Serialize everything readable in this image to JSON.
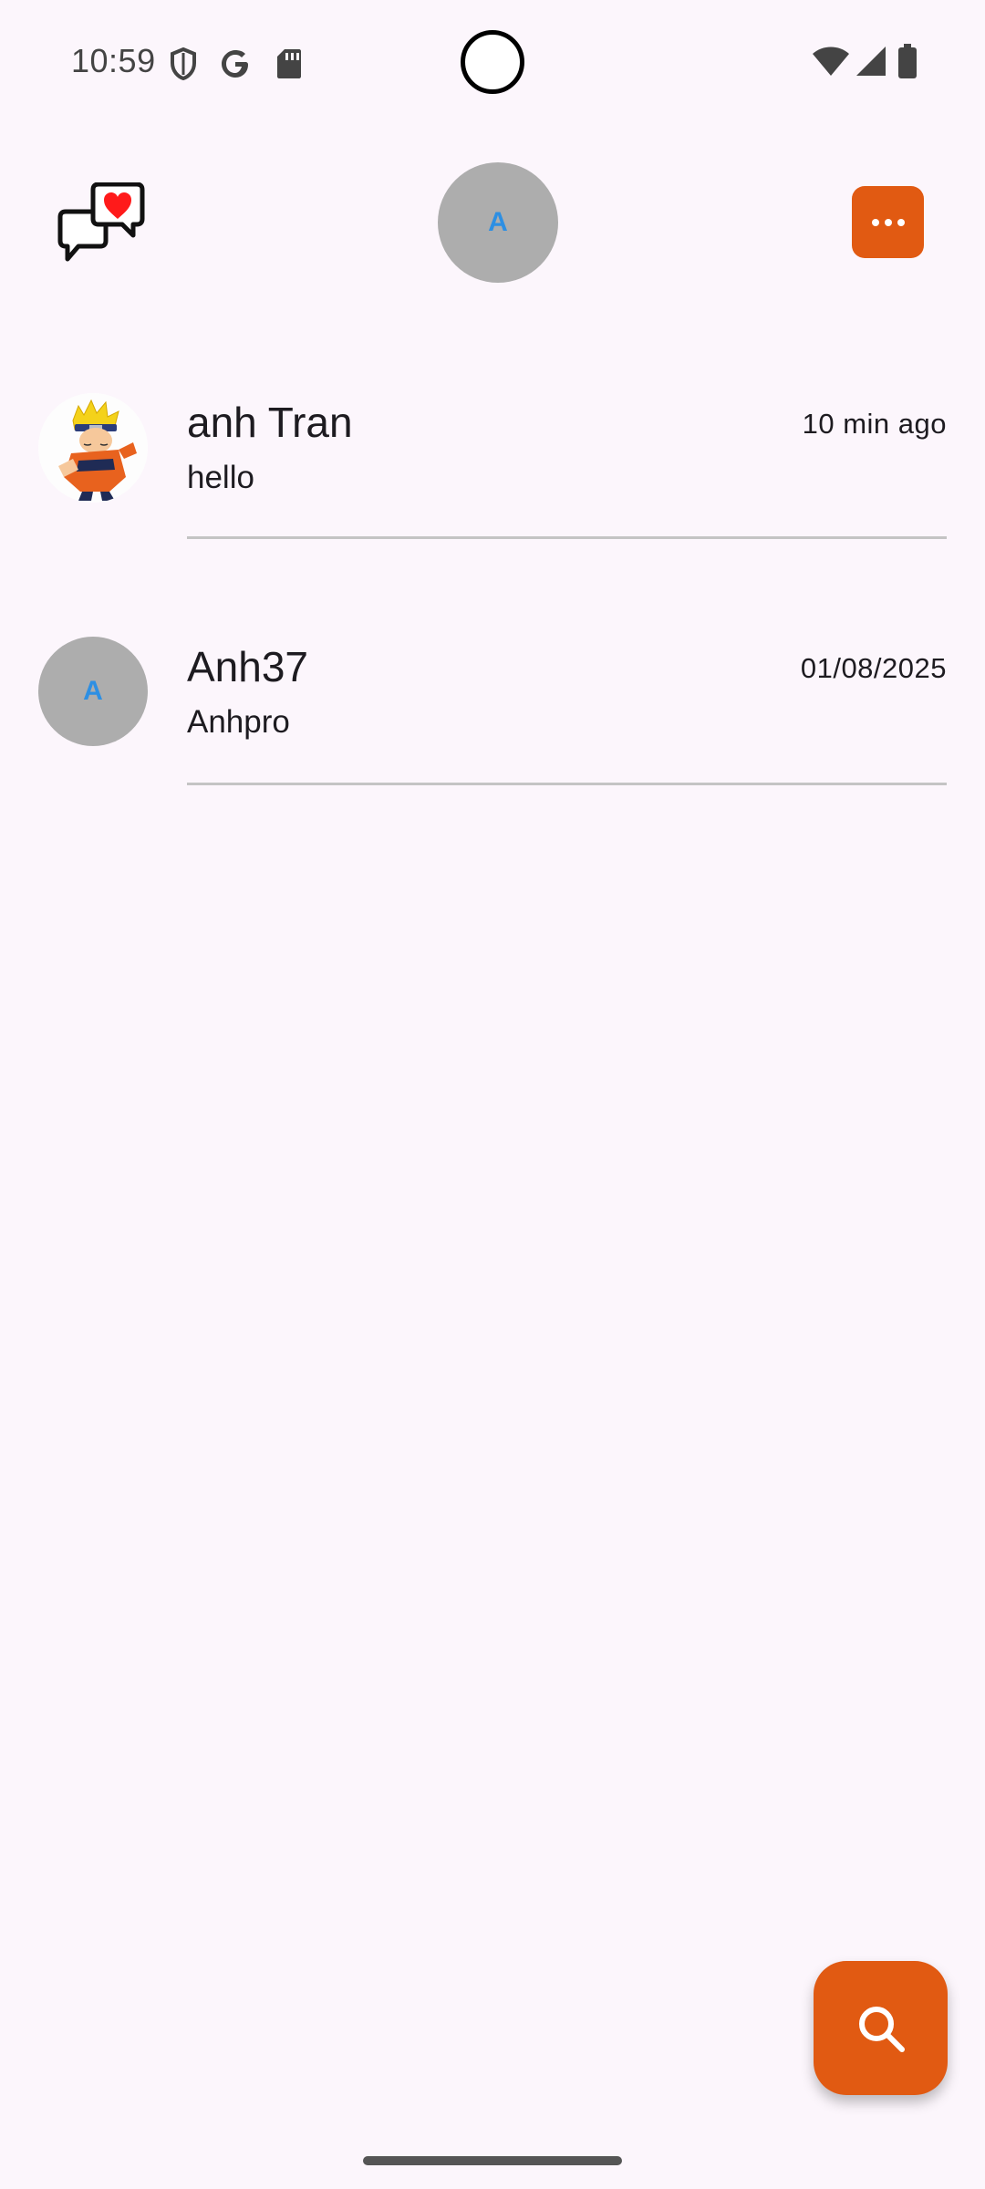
{
  "status_bar": {
    "time": "10:59",
    "left_icons": [
      "shield-icon",
      "google-icon",
      "sd-card-icon"
    ],
    "right_icons": [
      "wifi-icon",
      "signal-icon",
      "battery-icon"
    ]
  },
  "header": {
    "logo_icon": "chat-heart-icon",
    "avatar_initial": "A",
    "menu_icon": "more-horizontal-icon"
  },
  "conversations": [
    {
      "name": "anh Tran",
      "time": "10 min ago",
      "last_message": "hello",
      "avatar": "anime-character-photo"
    },
    {
      "name": "Anh37",
      "time": "01/08/2025",
      "last_message": "Anhpro",
      "avatar_initial": "A"
    }
  ],
  "fab": {
    "icon": "search-icon"
  },
  "colors": {
    "accent": "#e15a12",
    "background": "#fcf6fc",
    "avatar_bg": "#adadad",
    "avatar_text": "#2d8fe3"
  }
}
